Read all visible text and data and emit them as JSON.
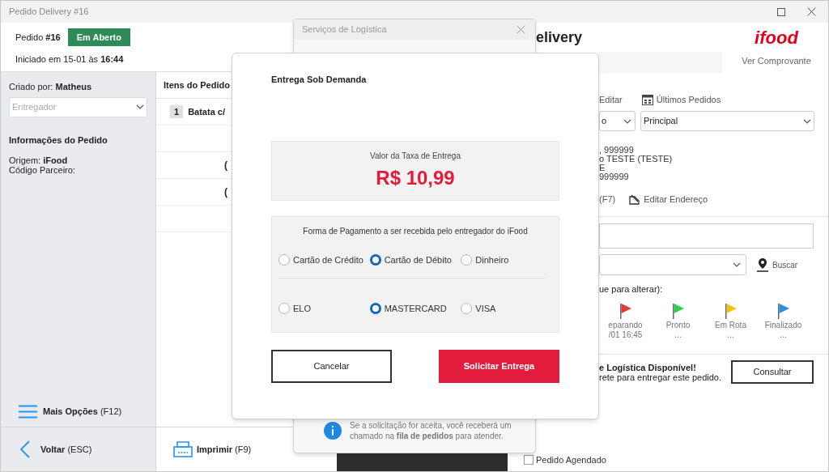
{
  "window": {
    "title": "Pedido Delivery #16"
  },
  "order_header": {
    "order": "Pedido **#16**",
    "status": "Em Aberto",
    "started": "Iniciado em 15-01 às **16:44**"
  },
  "sidebar": {
    "created_by": "Criado por: **Matheus**",
    "courier_select": {
      "placeholder": "Entregador"
    },
    "section_title": "Informações do Pedido",
    "info_lines": [
      "Origem: **iFood**",
      "Código Parceiro:"
    ],
    "more_options": "**Mais Opções** (F12)",
    "back": "**Voltar** (ESC)"
  },
  "items": {
    "title": "Itens do Pedido",
    "rows": [
      {
        "kind": "item",
        "quantity": "1",
        "name": "Batata c/"
      },
      {
        "kind": "blank"
      },
      {
        "kind": "note",
        "text": "("
      },
      {
        "kind": "note",
        "text": "("
      },
      {
        "kind": "blank"
      }
    ],
    "print_button": "**Imprimir** (F9)"
  },
  "delivery_panel": {
    "heading": "elivery",
    "logo": "ifood",
    "receipt_link": "Ver Comprovante",
    "edit_link": "Editar",
    "last_orders": "Últimos Pedidos",
    "type_select": {
      "value": "o"
    },
    "address_select": {
      "value": "Principal"
    },
    "customer_lines": [
      ", 999999",
      "o TESTE (TESTE)",
      "E",
      "999999"
    ],
    "shortcut": "(F7)",
    "edit_address": "Editar Endereço",
    "search_button": "Buscar",
    "status_hint": "ue para alterar):",
    "status_steps": [
      {
        "label": "eparando",
        "time": "/01 16:45",
        "color": "#e53935"
      },
      {
        "label": "Pronto",
        "time": "...",
        "color": "#2ecc55"
      },
      {
        "label": "Em Rota",
        "time": "...",
        "color": "#f1c40f"
      },
      {
        "label": "Finalizado",
        "time": "...",
        "color": "#2f8fdc"
      }
    ],
    "logistics": {
      "title": "e Logística Disponível!",
      "text": "rete para entregar este pedido.",
      "button": "Consultar"
    },
    "scheduled": {
      "label": "Pedido Agendado",
      "checked": false
    }
  },
  "logistics_dialog": {
    "title": "Serviços de Logística",
    "info": "Se a solicitação for aceita, você receberá um chamado na **fila de pedidos** para atender."
  },
  "delivery_dialog": {
    "title": "Entrega Sob Demanda",
    "fee_label": "Valor da Taxa de Entrega",
    "fee": "R$ 10,99",
    "payment_title": "Forma de Pagamento a ser recebida pelo entregador do iFood",
    "payment_types": [
      {
        "label": "Cartão de Crédito",
        "selected": false
      },
      {
        "label": "Cartão de Débito",
        "selected": true
      },
      {
        "label": "Dinheiro",
        "selected": false
      }
    ],
    "card_brands": [
      {
        "label": "ELO",
        "selected": false
      },
      {
        "label": "MASTERCARD",
        "selected": true
      },
      {
        "label": "VISA",
        "selected": false
      }
    ],
    "cancel_button": "Cancelar",
    "submit_button": "Solicitar Entrega"
  }
}
